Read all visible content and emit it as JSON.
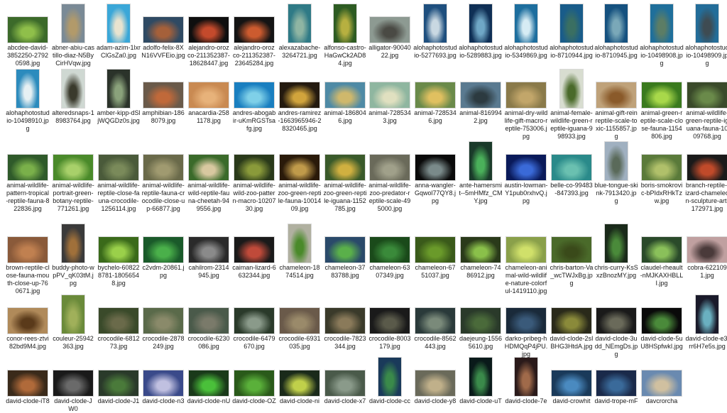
{
  "files": [
    {
      "name": "abcdee-david-3852250-27920598.jpg",
      "bg": "#3c6a2a",
      "fg": "#8fbf4a",
      "portrait": false
    },
    {
      "name": "abner-abiu-castillo-diaz-N5ByCirHVqw.jpg",
      "bg": "#7a8a96",
      "fg": "#b29a6a",
      "portrait": true
    },
    {
      "name": "adam-azim-1lxrClGsZa0.jpg",
      "bg": "#3aa7d8",
      "fg": "#e9e3cf",
      "portrait": true
    },
    {
      "name": "adolfo-felix-8XN16VVFEio.jpg",
      "bg": "#2f4a63",
      "fg": "#a5603a",
      "portrait": false
    },
    {
      "name": "alejandro-orozco-211352387-18628447.jpg",
      "bg": "#0f0f0f",
      "fg": "#c44a2c",
      "portrait": false
    },
    {
      "name": "alejandro-orozco-211352387-23645284.jpg",
      "bg": "#141414",
      "fg": "#cc5b2f",
      "portrait": false
    },
    {
      "name": "alexazabache-3264721.jpg",
      "bg": "#2f7a86",
      "fg": "#8fb5a3",
      "portrait": true
    },
    {
      "name": "alfonso-castro-HaGwCk2AD84.jpg",
      "bg": "#2d5b22",
      "fg": "#b7b040",
      "portrait": true
    },
    {
      "name": "alligator-9004022.jpg",
      "bg": "#8d9a92",
      "fg": "#4a4a44",
      "portrait": false
    },
    {
      "name": "alohaphotostudio-5277693.jpg",
      "bg": "#1e4f7e",
      "fg": "#c9d8e2",
      "portrait": true
    },
    {
      "name": "alohaphotostudio-5289883.jpg",
      "bg": "#0f2f55",
      "fg": "#6fa7c6",
      "portrait": true
    },
    {
      "name": "alohaphotostudio-5349869.jpg",
      "bg": "#1d6e9e",
      "fg": "#d6ecf4",
      "portrait": true
    },
    {
      "name": "alohaphotostudio-8710944.jpg",
      "bg": "#195c8a",
      "fg": "#3a6f62",
      "portrait": true
    },
    {
      "name": "alohaphotostudio-8710945.jpg",
      "bg": "#15517f",
      "fg": "#7aa8b8",
      "portrait": true
    },
    {
      "name": "alohaphotostudio-10498908.jpg",
      "bg": "#1f6f9b",
      "fg": "#5c7d65",
      "portrait": true
    },
    {
      "name": "alohaphotostudio-10498909.jpg",
      "bg": "#236d99",
      "fg": "#3e4b52",
      "portrait": true
    },
    {
      "name": "alohaphotostudio-10498910.jpg",
      "bg": "#2c8bbd",
      "fg": "#e6f0f3",
      "portrait": true
    },
    {
      "name": "alteredsnaps-18983764.jpg",
      "bg": "#cfd8d2",
      "fg": "#3a3a2c",
      "portrait": true
    },
    {
      "name": "amber-kipp-dSljWQGDz0s.jpg",
      "bg": "#2b332a",
      "fg": "#8aa27b",
      "portrait": true
    },
    {
      "name": "amphibian-1868079.jpg",
      "bg": "#6a5a4a",
      "fg": "#c0693a",
      "portrait": false
    },
    {
      "name": "anacardia-2581178.jpg",
      "bg": "#c98a52",
      "fg": "#e7b27a",
      "portrait": false
    },
    {
      "name": "andres-abogabir-uKmRGSTsafg.jpg",
      "bg": "#1a7fc0",
      "fg": "#7fd0e8",
      "portrait": false
    },
    {
      "name": "andres-ramirez-1663965946-28320465.jpg",
      "bg": "#241a0f",
      "fg": "#d1a43c",
      "portrait": false
    },
    {
      "name": "animal-1868046.jpg",
      "bg": "#4f8aa5",
      "fg": "#cfb86c",
      "portrait": false
    },
    {
      "name": "animal-7285343.jpg",
      "bg": "#8fb6a0",
      "fg": "#e0e0c0",
      "portrait": false
    },
    {
      "name": "animal-7285346.jpg",
      "bg": "#6a8a4a",
      "fg": "#e0c060",
      "portrait": false
    },
    {
      "name": "animal-8169942.jpg",
      "bg": "#5a7a90",
      "fg": "#2c3a40",
      "portrait": false
    },
    {
      "name": "animal-dry-wildlife-gift-macro-reptile-753006.jpg",
      "bg": "#8a7a4a",
      "fg": "#c2a66a",
      "portrait": false
    },
    {
      "name": "animal-female-wildlife-green-reptile-iguana-998933.jpg",
      "bg": "#d8ddd0",
      "fg": "#4a6a2a",
      "portrait": true
    },
    {
      "name": "animal-gift-reinreptile-scale-toxic-1155857.jpg",
      "bg": "#bfa27a",
      "fg": "#8a5a2a",
      "portrait": false
    },
    {
      "name": "animal-green-reptile-scale-close-fauna-1154806.jpg",
      "bg": "#3a7a1e",
      "fg": "#a8d84a",
      "portrait": false
    },
    {
      "name": "animal-wildlife-green-reptile-iguana-fauna-1009768.jpg",
      "bg": "#3a4a2a",
      "fg": "#6a8a4a",
      "portrait": false
    },
    {
      "name": "animal-wildlife-pattern-tropical-reptile-fauna-822836.jpg",
      "bg": "#2f5a2a",
      "fg": "#7ab04a",
      "portrait": false
    },
    {
      "name": "animal-wildlife-portrait-green-botany-reptile-771261.jpg",
      "bg": "#4a8a2a",
      "fg": "#a8d06a",
      "portrait": false
    },
    {
      "name": "animal-wildlife-reptile-close-fauna-crocodile-1256114.jpg",
      "bg": "#4a5a3a",
      "fg": "#7a8a5a",
      "portrait": false
    },
    {
      "name": "animal-wildlife-reptile-fauna-crocodile-close-up-66877.jpg",
      "bg": "#6a6a4a",
      "fg": "#a09a70",
      "portrait": false
    },
    {
      "name": "animal-wildlife-wild-reptile-fauna-cheetah-949556.jpg",
      "bg": "#3a6a2a",
      "fg": "#d8c8a0",
      "portrait": false
    },
    {
      "name": "animal-wildlife-wild-zoo-pattern-macro-1020730.jpg",
      "bg": "#2a3a1a",
      "fg": "#8a9a3a",
      "portrait": false
    },
    {
      "name": "animal-wildlife-zoo-green-reptile-fauna-1001409.jpg",
      "bg": "#2a1a0a",
      "fg": "#c09a4a",
      "portrait": false
    },
    {
      "name": "animal-wildlife-zoo-green-reptile-iguana-1152785.jpg",
      "bg": "#3a5a2a",
      "fg": "#d0b040",
      "portrait": false
    },
    {
      "name": "animal-wildlife-zoo-predator-reptile-scale-495000.jpg",
      "bg": "#6a6a5a",
      "fg": "#a0a08a",
      "portrait": false
    },
    {
      "name": "anna-wangler-Gqwol77QY8.jpg",
      "bg": "#0a0a0a",
      "fg": "#7a8a8a",
      "portrait": false
    },
    {
      "name": "ante-hamersmit--5mHMfz_CMY.jpg",
      "bg": "#1a3a2a",
      "fg": "#4ab05a",
      "portrait": true
    },
    {
      "name": "austin-lowman-Y1pub0rxhvQ.jpg",
      "bg": "#0a1a5a",
      "fg": "#3a6ad8",
      "portrait": false
    },
    {
      "name": "belle-co-99483-847393.jpg",
      "bg": "#2a8a8a",
      "fg": "#6ac0b0",
      "portrait": false
    },
    {
      "name": "blue-tongue-skink-7913420.jpg",
      "bg": "#a0b0c0",
      "fg": "#5a6a5a",
      "portrait": true
    },
    {
      "name": "boris-smokrovic-bPIdxRHkTzw.jpg",
      "bg": "#5a7a3a",
      "fg": "#b0c06a",
      "portrait": false
    },
    {
      "name": "branch-reptile-lizard-chameleon-sculpture-art-172971.jpg",
      "bg": "#1a1a1a",
      "fg": "#c04a2a",
      "portrait": false
    },
    {
      "name": "brown-reptile-close-fauna-mouth-close-up-760671.jpg",
      "bg": "#8a5a3a",
      "fg": "#c08050",
      "portrait": false
    },
    {
      "name": "buddy-photo-wpPV_qK03tM.jpg",
      "bg": "#3a3a3a",
      "fg": "#a0703a",
      "portrait": true
    },
    {
      "name": "bychelo-608228781-18056548.jpg",
      "bg": "#3a6a1a",
      "fg": "#9ad04a",
      "portrait": false
    },
    {
      "name": "c2vdm-20861.jpg",
      "bg": "#1a5a2a",
      "fg": "#4ab04a",
      "portrait": false
    },
    {
      "name": "cahilrom-2314945.jpg",
      "bg": "#2a2a2a",
      "fg": "#8a8a8a",
      "portrait": false
    },
    {
      "name": "caiman-lizard-6632344.jpg",
      "bg": "#1a1a1a",
      "fg": "#c04a3a",
      "portrait": false
    },
    {
      "name": "chameleon-1874514.jpg",
      "bg": "#b0b0a0",
      "fg": "#4a8a2a",
      "portrait": true
    },
    {
      "name": "chameleon-3783788.jpg",
      "bg": "#2a4a6a",
      "fg": "#5ab04a",
      "portrait": false
    },
    {
      "name": "chameleon-6307349.jpg",
      "bg": "#1a4a1a",
      "fg": "#3a8a3a",
      "portrait": false
    },
    {
      "name": "chameleon-6751037.jpg",
      "bg": "#3a5a1a",
      "fg": "#6a9a2a",
      "portrait": false
    },
    {
      "name": "chameleon-7486912.jpg",
      "bg": "#2a3a1a",
      "fg": "#8ac04a",
      "portrait": false
    },
    {
      "name": "chameleon-animal-wild-wildlife-nature-colorful-1419110.jpg",
      "bg": "#8aa04a",
      "fg": "#d0e06a",
      "portrait": false
    },
    {
      "name": "chris-barton-Va_wcTWJxBg.jpg",
      "bg": "#4a6a2a",
      "fg": "#3a4a1a",
      "portrait": false
    },
    {
      "name": "chris-curry-KsSxzBnozMY.jpg",
      "bg": "#1a2a1a",
      "fg": "#4a8a3a",
      "portrait": true
    },
    {
      "name": "claudel-rheault-nMJKAXHBLLI.jpg",
      "bg": "#2a4a2a",
      "fg": "#8ac05a",
      "portrait": false
    },
    {
      "name": "cobra-6221091.jpg",
      "bg": "#c0a0a0",
      "fg": "#4a3a3a",
      "portrait": false
    },
    {
      "name": "conor-rees-ztvi82bd9M4.jpg",
      "bg": "#b08a5a",
      "fg": "#5a3a1a",
      "portrait": false
    },
    {
      "name": "couleur-25942363.jpg",
      "bg": "#6a8a3a",
      "fg": "#a0b05a",
      "portrait": true
    },
    {
      "name": "crocodile-681273.jpg",
      "bg": "#3a4a2a",
      "fg": "#6a6a4a",
      "portrait": false
    },
    {
      "name": "crocodile-2878249.jpg",
      "bg": "#5a6a4a",
      "fg": "#8a8a6a",
      "portrait": false
    },
    {
      "name": "crocodile-6230086.jpg",
      "bg": "#4a5a4a",
      "fg": "#7a7a6a",
      "portrait": false
    },
    {
      "name": "crocodile-6479670.jpg",
      "bg": "#2a3a2a",
      "fg": "#8a9a8a",
      "portrait": false
    },
    {
      "name": "crocodile-6931035.jpg",
      "bg": "#6a5a4a",
      "fg": "#9a8a6a",
      "portrait": false
    },
    {
      "name": "crocodile-7823344.jpg",
      "bg": "#3a3a2a",
      "fg": "#8a7a5a",
      "portrait": false
    },
    {
      "name": "crocodile-8003179.jpg",
      "bg": "#1a1a1a",
      "fg": "#5a5a4a",
      "portrait": false
    },
    {
      "name": "crocodile-8562443.jpg",
      "bg": "#2a3a3a",
      "fg": "#7a8a7a",
      "portrait": false
    },
    {
      "name": "daejeung-15565610.jpg",
      "bg": "#2a3a2a",
      "fg": "#4a6a3a",
      "portrait": false
    },
    {
      "name": "darko-pribeg-hHDMQqP4jPU.jpg",
      "bg": "#1a2a3a",
      "fg": "#3a5a7a",
      "portrait": false
    },
    {
      "name": "david-clode-2sIBHG3HtdA.jpg",
      "bg": "#2a2a1a",
      "fg": "#8a8a3a",
      "portrait": false
    },
    {
      "name": "david-clode-3udd_NEmgDs.jpg",
      "bg": "#1a1a1a",
      "fg": "#6a6a5a",
      "portrait": false
    },
    {
      "name": "david-clode-5uU8HSpfwkI.jpg",
      "bg": "#0a0a0a",
      "fg": "#4a8a3a",
      "portrait": false
    },
    {
      "name": "david-clode-e3irr6H7e5s.jpg",
      "bg": "#1a1a2a",
      "fg": "#6ab0c0",
      "portrait": true
    },
    {
      "name": "david-clode-iT8",
      "bg": "#3a2a1a",
      "fg": "#b06a3a",
      "portrait": false
    },
    {
      "name": "david-clode-JW0",
      "bg": "#1a1a1a",
      "fg": "#6a6a6a",
      "portrait": false
    },
    {
      "name": "david-clode-J1",
      "bg": "#2a3a2a",
      "fg": "#4a7a3a",
      "portrait": false
    },
    {
      "name": "david-clode-n3",
      "bg": "#3a4a8a",
      "fg": "#c0c0e0",
      "portrait": false
    },
    {
      "name": "david-clode-nU",
      "bg": "#1a3a1a",
      "fg": "#4ac03a",
      "portrait": false
    },
    {
      "name": "david-clode-OZ",
      "bg": "#2a5a1a",
      "fg": "#5ab03a",
      "portrait": false
    },
    {
      "name": "david-clode-ni",
      "bg": "#1a2a1a",
      "fg": "#c0d04a",
      "portrait": false
    },
    {
      "name": "david-clode-x7",
      "bg": "#4a5a4a",
      "fg": "#8a9a8a",
      "portrait": false
    },
    {
      "name": "david-clode-cc",
      "bg": "#1a3a5a",
      "fg": "#3a8a4a",
      "portrait": true
    },
    {
      "name": "david-clode-y8",
      "bg": "#6a6a5a",
      "fg": "#c0b08a",
      "portrait": false
    },
    {
      "name": "david-clode-uT",
      "bg": "#0a1a1a",
      "fg": "#3a8a4a",
      "portrait": true
    },
    {
      "name": "david-clode-7e",
      "bg": "#2a1a1a",
      "fg": "#a06a4a",
      "portrait": true
    },
    {
      "name": "david-crowhit",
      "bg": "#1a3a5a",
      "fg": "#4a8ac0",
      "portrait": false
    },
    {
      "name": "david-trope-mF",
      "bg": "#1a2a4a",
      "fg": "#3a6a9a",
      "portrait": false
    },
    {
      "name": "davcrorcha",
      "bg": "#6a8ab0",
      "fg": "#d0c0a0",
      "portrait": false
    }
  ]
}
